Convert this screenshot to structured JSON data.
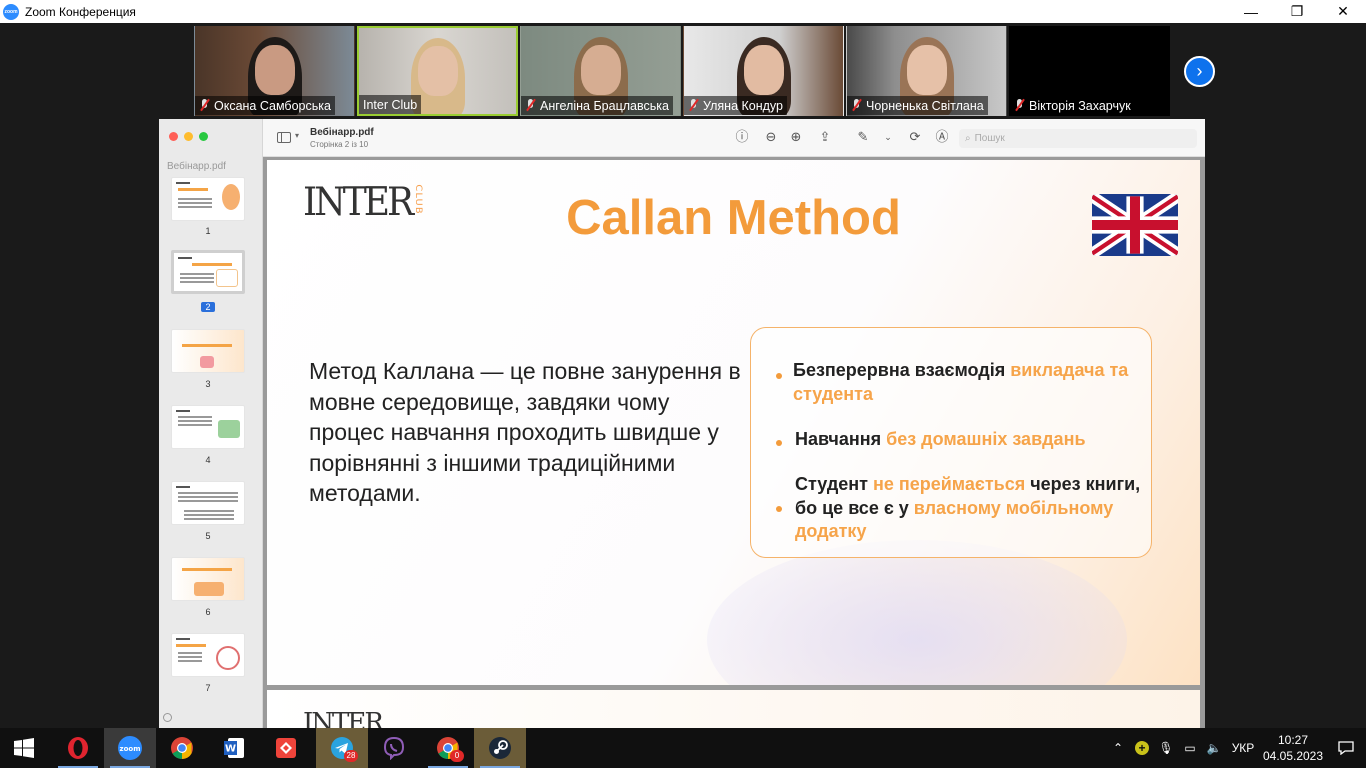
{
  "window": {
    "title": "Zoom Конференция",
    "minimize": "—",
    "restore": "❐",
    "close": "✕"
  },
  "participants": [
    {
      "name": "Оксана Самборська",
      "muted": true,
      "active": false
    },
    {
      "name": "Inter Club",
      "muted": false,
      "active": true
    },
    {
      "name": "Ангеліна Брацлавська",
      "muted": true,
      "active": false
    },
    {
      "name": "Уляна Кондур",
      "muted": true,
      "active": false
    },
    {
      "name": "Чорненька Світлана",
      "muted": true,
      "active": false
    },
    {
      "name": "Вікторія Захарчук",
      "muted": true,
      "active": false
    }
  ],
  "preview": {
    "sidebar_file": "Вебінарр.pdf",
    "doc_name": "Вебінарр.pdf",
    "page_info": "Сторінка 2 із 10",
    "search_placeholder": "Пошук",
    "thumbnails": [
      "1",
      "2",
      "3",
      "4",
      "5",
      "6",
      "7"
    ],
    "selected_page": "2"
  },
  "slide": {
    "brand": "INTER",
    "brand_sub": "CLUB",
    "title": "Callan Method",
    "body": "Метод Каллана — це повне занурення в мовне середовище, завдяки чому процес навчання проходить швидше у порівнянні з іншими традиційними методами.",
    "benefits": [
      {
        "plain1": "Безперервна взаємодія ",
        "hl1": "викладача та студента",
        "plain2": "",
        "hl2": "",
        "plain3": ""
      },
      {
        "plain1": "Навчання ",
        "hl1": "без домашніх завдань",
        "plain2": "",
        "hl2": "",
        "plain3": ""
      },
      {
        "plain1": "Студент ",
        "hl1": "не переймається",
        "plain2": " через книги, бо це все є у ",
        "hl2": "власному мобільному додатку",
        "plain3": ""
      }
    ]
  },
  "taskbar": {
    "apps": [
      "Opera",
      "Zoom",
      "Chrome",
      "Word",
      "AnyDesk",
      "Telegram",
      "Viber",
      "Chrome",
      "Steam"
    ],
    "telegram_badge": "28",
    "chrome_badge": "0",
    "language": "УКР",
    "time": "10:27",
    "date": "04.05.2023"
  },
  "colors": {
    "accent_orange": "#f39b3b",
    "zoom_blue": "#0e72ed",
    "active_speaker": "#9acd32"
  }
}
